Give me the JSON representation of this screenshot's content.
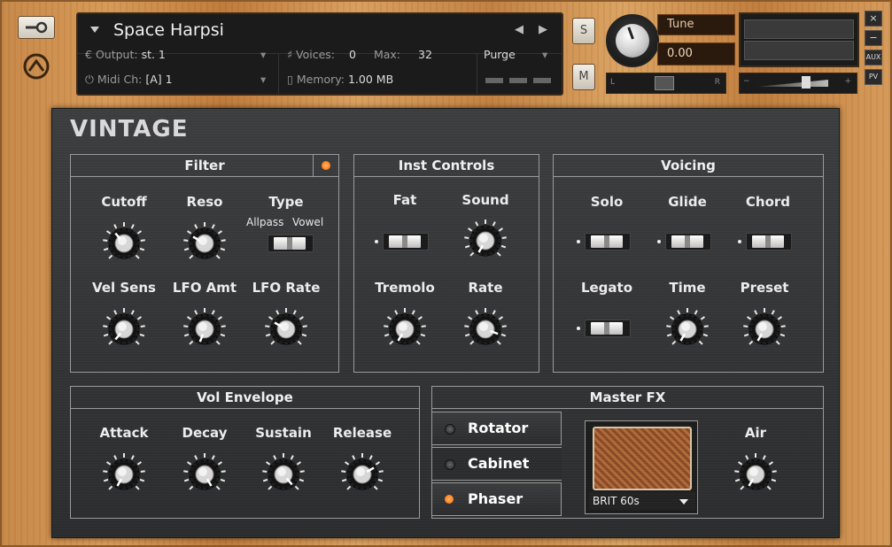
{
  "header": {
    "instrument_name": "Space Harpsi",
    "output_label": "Output:",
    "output_value": "st. 1",
    "midi_label": "Midi Ch:",
    "midi_value": "[A] 1",
    "voices_label": "Voices:",
    "voices_value": "0",
    "max_label": "Max:",
    "max_value": "32",
    "memory_label": "Memory:",
    "memory_value": "1.00 MB",
    "purge_label": "Purge",
    "solo_button": "S",
    "mute_button": "M",
    "tune_label": "Tune",
    "tune_value": "0.00",
    "pan_left": "L",
    "pan_right": "R",
    "aux_label": "AUX",
    "pv_label": "PV",
    "close_label": "×",
    "minimize_label": "−"
  },
  "panel": {
    "title": "VINTAGE",
    "filter": {
      "title": "Filter",
      "cutoff": "Cutoff",
      "reso": "Reso",
      "type": "Type",
      "type_left": "Allpass",
      "type_right": "Vowel",
      "vel_sens": "Vel Sens",
      "lfo_amt": "LFO Amt",
      "lfo_rate": "LFO Rate"
    },
    "inst_controls": {
      "title": "Inst Controls",
      "fat": "Fat",
      "sound": "Sound",
      "tremolo": "Tremolo",
      "rate": "Rate"
    },
    "voicing": {
      "title": "Voicing",
      "solo": "Solo",
      "glide": "Glide",
      "chord": "Chord",
      "legato": "Legato",
      "time": "Time",
      "preset": "Preset"
    },
    "vol_envelope": {
      "title": "Vol Envelope",
      "attack": "Attack",
      "decay": "Decay",
      "sustain": "Sustain",
      "release": "Release"
    },
    "master_fx": {
      "title": "Master FX",
      "rotator": "Rotator",
      "cabinet": "Cabinet",
      "phaser": "Phaser",
      "cabinet_model": "BRIT 60s",
      "air": "Air"
    }
  },
  "colors": {
    "led_on": "#ff7a1a",
    "led_off": "#3a3a3a",
    "wood": "#c88a4a"
  }
}
